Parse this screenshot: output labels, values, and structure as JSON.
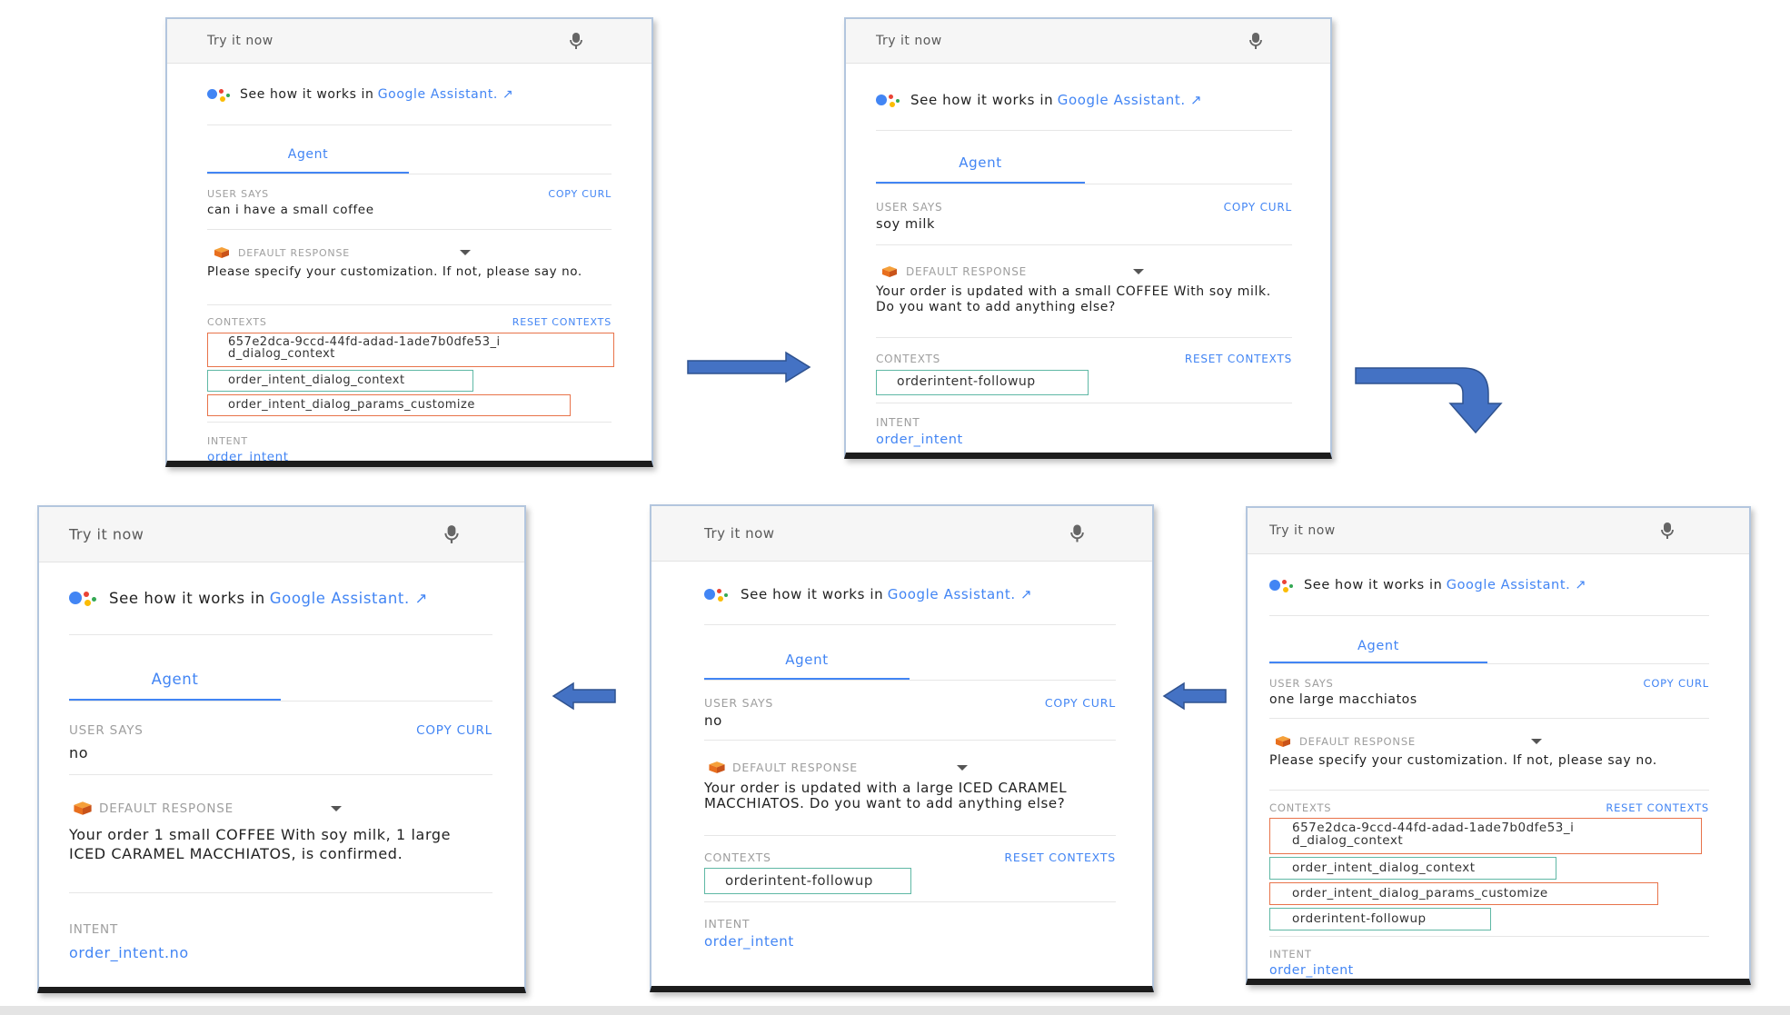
{
  "common": {
    "header": "Try it now",
    "see_how": "See how it works in",
    "google_assistant": "Google Assistant.",
    "tab_agent": "Agent",
    "user_says_label": "USER SAYS",
    "copy_curl": "COPY CURL",
    "default_response_label": "DEFAULT RESPONSE",
    "contexts_label": "CONTEXTS",
    "reset_contexts": "RESET CONTEXTS",
    "intent_label": "INTENT"
  },
  "panels": [
    {
      "step": 1,
      "user_says": "can i have a small coffee",
      "response": "Please specify your customization. If not, please say no.",
      "contexts": [
        {
          "name": "657e2dca-9ccd-44fd-adad-1ade7b0dfe53_id_dialog_context",
          "line1": "657e2dca-9ccd-44fd-adad-1ade7b0dfe53_i",
          "line2": "d_dialog_context",
          "color": "orange"
        },
        {
          "name": "order_intent_dialog_context",
          "color": "green"
        },
        {
          "name": "order_intent_dialog_params_customize",
          "color": "orange"
        }
      ],
      "intent": "order_intent"
    },
    {
      "step": 2,
      "user_says": "soy milk",
      "response": "Your order is updated with a small COFFEE With soy milk. Do you want to add anything else?",
      "contexts": [
        {
          "name": "orderintent-followup",
          "color": "green"
        }
      ],
      "intent": "order_intent"
    },
    {
      "step": 3,
      "user_says": "one large macchiatos",
      "response": "Please specify your customization. If not, please say no.",
      "contexts": [
        {
          "name": "657e2dca-9ccd-44fd-adad-1ade7b0dfe53_id_dialog_context",
          "line1": "657e2dca-9ccd-44fd-adad-1ade7b0dfe53_i",
          "line2": "d_dialog_context",
          "color": "orange"
        },
        {
          "name": "order_intent_dialog_context",
          "color": "green"
        },
        {
          "name": "order_intent_dialog_params_customize",
          "color": "orange"
        },
        {
          "name": "orderintent-followup",
          "color": "green"
        }
      ],
      "intent": "order_intent"
    },
    {
      "step": 4,
      "user_says": "no",
      "response": "Your order is updated with a large ICED CARAMEL MACCHIATOS. Do you want to add anything else?",
      "contexts": [
        {
          "name": "orderintent-followup",
          "color": "green"
        }
      ],
      "intent": "order_intent"
    },
    {
      "step": 5,
      "user_says": "no",
      "response": "Your order 1 small COFFEE With soy milk, 1 large ICED CARAMEL MACCHIATOS, is confirmed.",
      "contexts": [],
      "intent": "order_intent.no"
    }
  ],
  "colors": {
    "link": "#4285f4",
    "context_orange": "#e8734a",
    "context_green": "#5fb8a5",
    "arrow": "#4472c4"
  },
  "icons": [
    "microphone-icon",
    "google-assistant-dots-icon",
    "external-link-icon",
    "response-cube-icon",
    "dropdown-caret-icon",
    "flow-arrow-icon"
  ]
}
